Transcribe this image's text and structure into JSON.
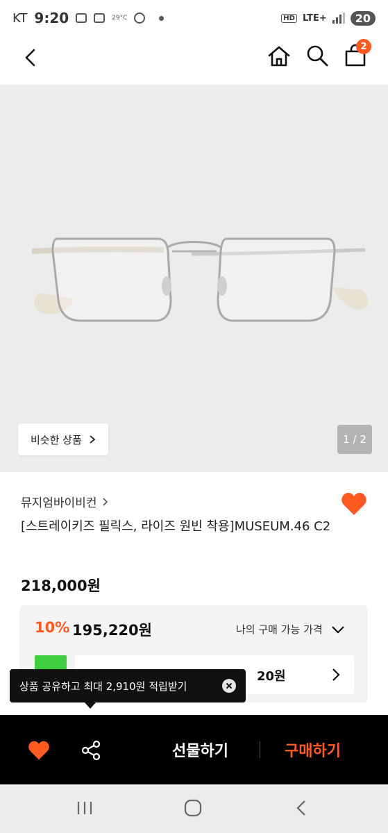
{
  "status_bar": {
    "carrier": "KT",
    "time": "9:20",
    "temperature": "29°C",
    "network": "LTE+",
    "hd": "HD",
    "battery": "20"
  },
  "header": {
    "cart_badge": "2",
    "icons": [
      "back-icon",
      "home-icon",
      "search-icon",
      "shopping-bag-icon"
    ]
  },
  "hero": {
    "similar_button": "비슷한 상품",
    "page_indicator": "1 / 2"
  },
  "product": {
    "brand": "뮤지엄바이비컨",
    "title": "[스트레이키즈 필릭스, 라이즈 원빈 착용]MUSEUM.46 C2",
    "original_price": "218,000원",
    "discount": "10%",
    "sale_price": "195,220원",
    "my_price_label": "나의 구매 가능 가격",
    "coupon_price": "20원"
  },
  "tooltip": {
    "text": "상품 공유하고 최대 2,910원 적립받기"
  },
  "action_bar": {
    "gift_label": "선물하기",
    "buy_label": "구매하기"
  },
  "colors": {
    "accent": "#ff5a1f",
    "dark": "#000000",
    "hero_bg": "#ececec"
  }
}
